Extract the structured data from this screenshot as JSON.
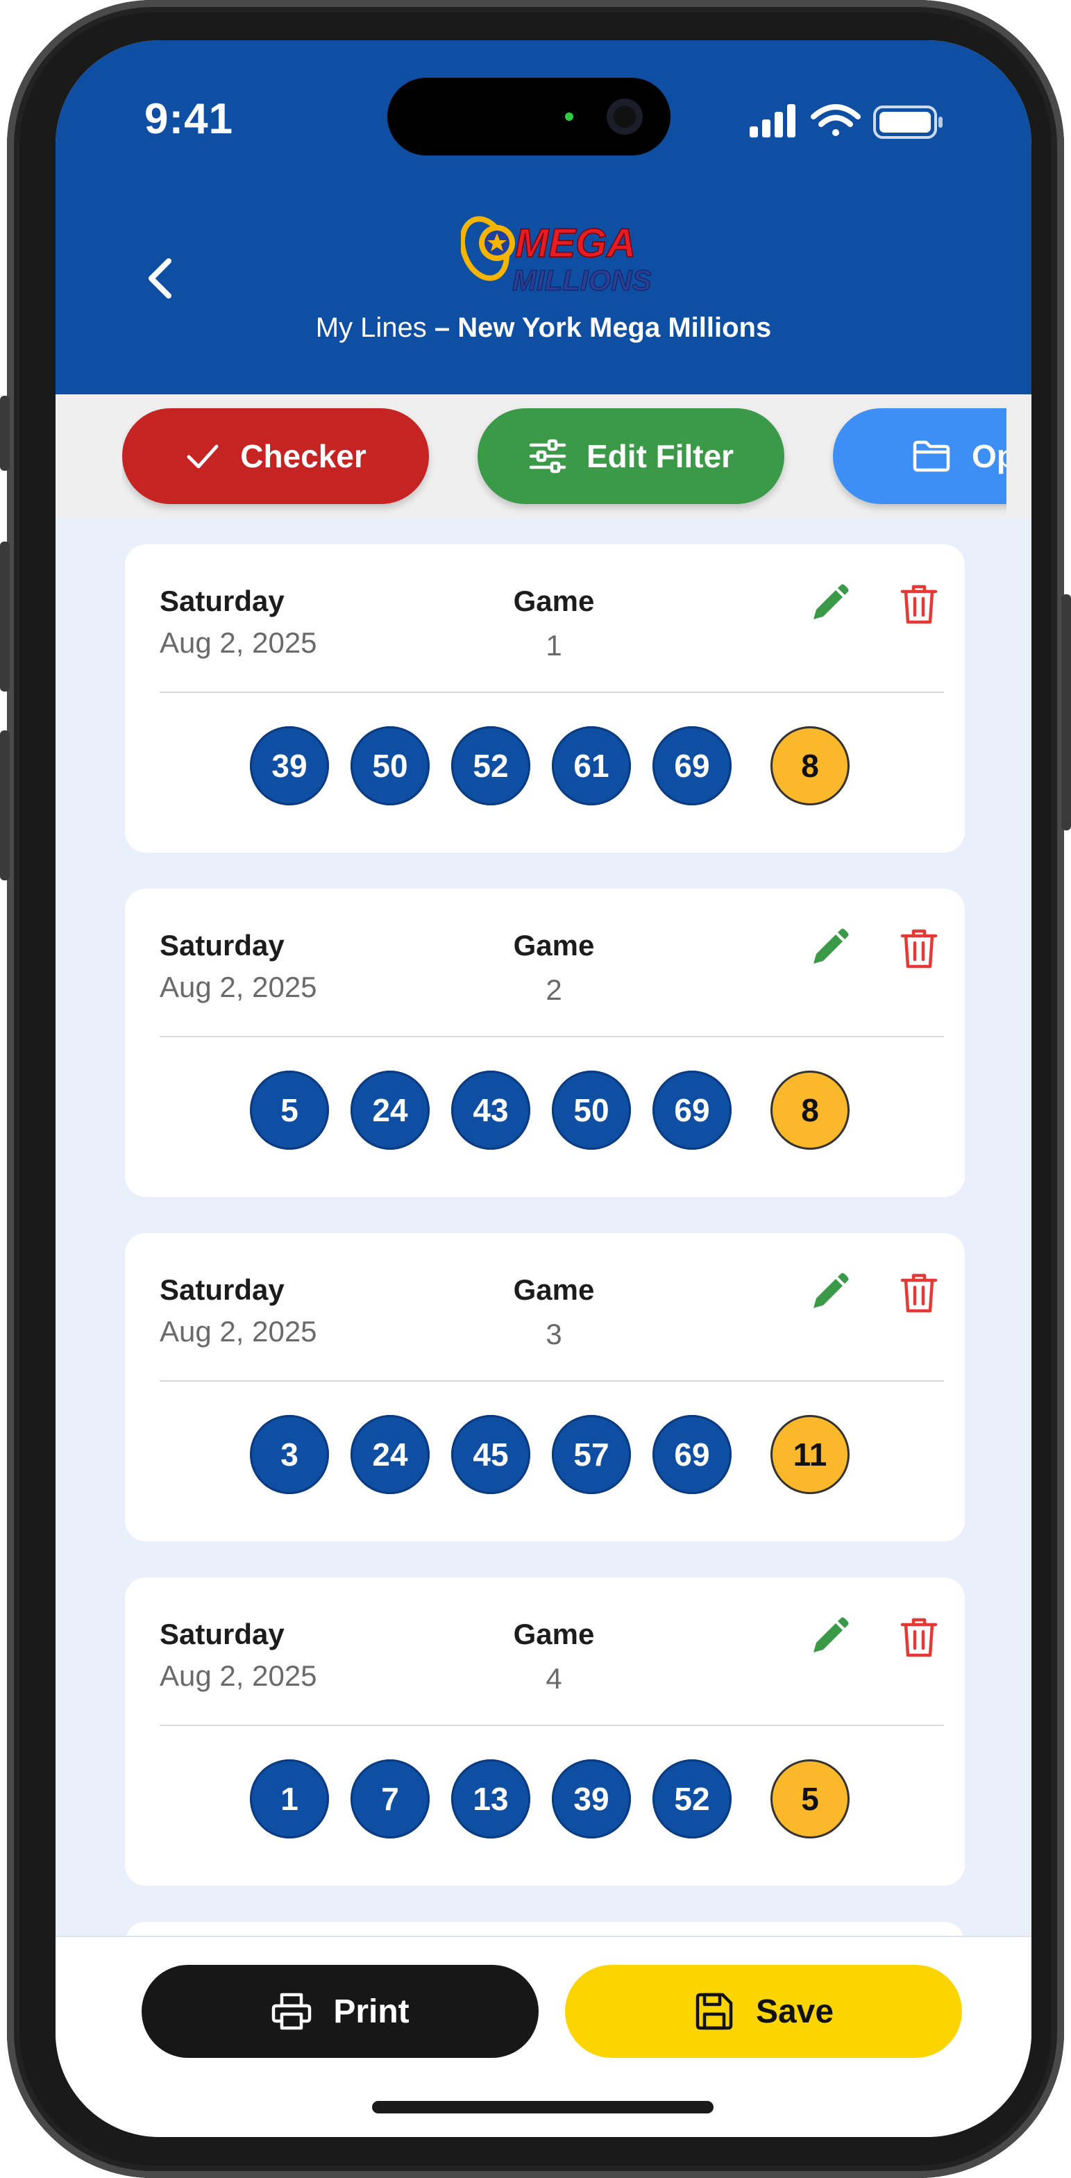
{
  "status_bar": {
    "time": "9:41"
  },
  "header": {
    "logo_text_top": "MEGA",
    "logo_text_bottom": "MILLIONS",
    "subtitle_prefix": "My Lines",
    "subtitle_main": " – New York Mega Millions"
  },
  "toolbar": {
    "checker_label": "Checker",
    "edit_filter_label": "Edit Filter",
    "open_label": "Open"
  },
  "lines": [
    {
      "day": "Saturday",
      "date": "Aug 2, 2025",
      "game_label": "Game",
      "game": "1",
      "numbers": [
        "39",
        "50",
        "52",
        "61",
        "69"
      ],
      "mega": "8"
    },
    {
      "day": "Saturday",
      "date": "Aug 2, 2025",
      "game_label": "Game",
      "game": "2",
      "numbers": [
        "5",
        "24",
        "43",
        "50",
        "69"
      ],
      "mega": "8"
    },
    {
      "day": "Saturday",
      "date": "Aug 2, 2025",
      "game_label": "Game",
      "game": "3",
      "numbers": [
        "3",
        "24",
        "45",
        "57",
        "69"
      ],
      "mega": "11"
    },
    {
      "day": "Saturday",
      "date": "Aug 2, 2025",
      "game_label": "Game",
      "game": "4",
      "numbers": [
        "1",
        "7",
        "13",
        "39",
        "52"
      ],
      "mega": "5"
    }
  ],
  "bottom_bar": {
    "print_label": "Print",
    "save_label": "Save"
  },
  "colors": {
    "header_blue": "#0e4ea3",
    "ball_blue": "#0e4ea3",
    "mega_ball": "#fbb82a",
    "checker_red": "#c62323",
    "edit_green": "#3a9a48",
    "open_blue": "#3d8ef5",
    "save_yellow": "#fcd500",
    "delete_red": "#e53935"
  }
}
